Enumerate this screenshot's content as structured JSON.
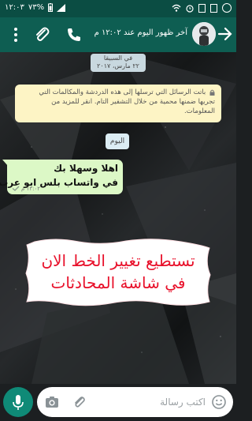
{
  "status_bar": {
    "time": "١٢:٠٣",
    "battery": "٧٣%",
    "icons": [
      "whatsapp-icon",
      "notification-icon",
      "image-icon",
      "alarm-icon",
      "wifi-icon",
      "signal-icon",
      "battery-icon"
    ]
  },
  "toolbar": {
    "last_seen": "آخر ظهور اليوم عند ١٢:٠٢ م",
    "icons": [
      "back-arrow-icon",
      "avatar",
      "call-icon",
      "attach-icon",
      "more-icon"
    ]
  },
  "chat": {
    "date_label_line1": "في السبيقا",
    "date_label_line2": "٢٢ مارس، ٢٠١٧",
    "encryption_notice": "باتت الرسائل التي ترسلها إلى هذه الدردشة والمكالمات التي تجريها ضمنها محمية من خلال التشفير التام. انقر للمزيد من المعلومات.",
    "today_label": "اليوم",
    "message": {
      "line1": "اهلا وسهلا بك",
      "line2": "في واتساب بلس ابو عرب",
      "time": "١٢:٠٢ م",
      "status": "sent"
    },
    "promo": {
      "line1": "تستطيع تغيير الخط الان",
      "line2": "في شاشة المحادثات",
      "color": "#e8102a"
    }
  },
  "input_bar": {
    "placeholder": "اكتب رسالة"
  },
  "colors": {
    "header": "#0e5e52",
    "status_bar": "#0b4d43",
    "accent": "#0f8a77",
    "bubble": "#dcf8c6"
  }
}
